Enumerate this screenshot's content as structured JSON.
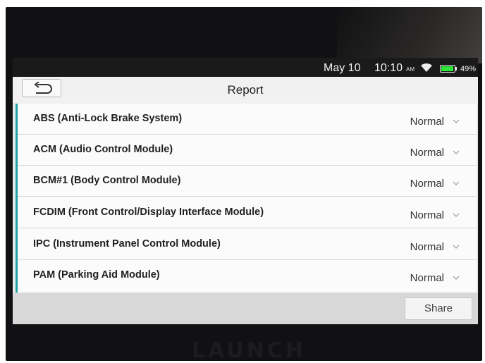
{
  "status_bar": {
    "date": "May 10",
    "time": "10:10",
    "ampm": "AM",
    "battery_percent": "49%",
    "battery_level": 0.49,
    "wifi_icon": "wifi-icon",
    "battery_icon": "battery-icon"
  },
  "header": {
    "title": "Report",
    "back_icon": "back-arrow-icon"
  },
  "modules": [
    {
      "name": "ABS (Anti-Lock Brake System)",
      "status": "Normal"
    },
    {
      "name": "ACM (Audio Control Module)",
      "status": "Normal"
    },
    {
      "name": "BCM#1 (Body Control Module)",
      "status": "Normal"
    },
    {
      "name": "FCDIM (Front Control/Display Interface Module)",
      "status": "Normal"
    },
    {
      "name": "IPC (Instrument Panel Control Module)",
      "status": "Normal"
    },
    {
      "name": "PAM (Parking Aid Module)",
      "status": "Normal"
    }
  ],
  "footer": {
    "share_label": "Share"
  },
  "device": {
    "brand": "LAUNCH"
  },
  "colors": {
    "accent": "#1ba3a0",
    "battery": "#2ee63a"
  }
}
